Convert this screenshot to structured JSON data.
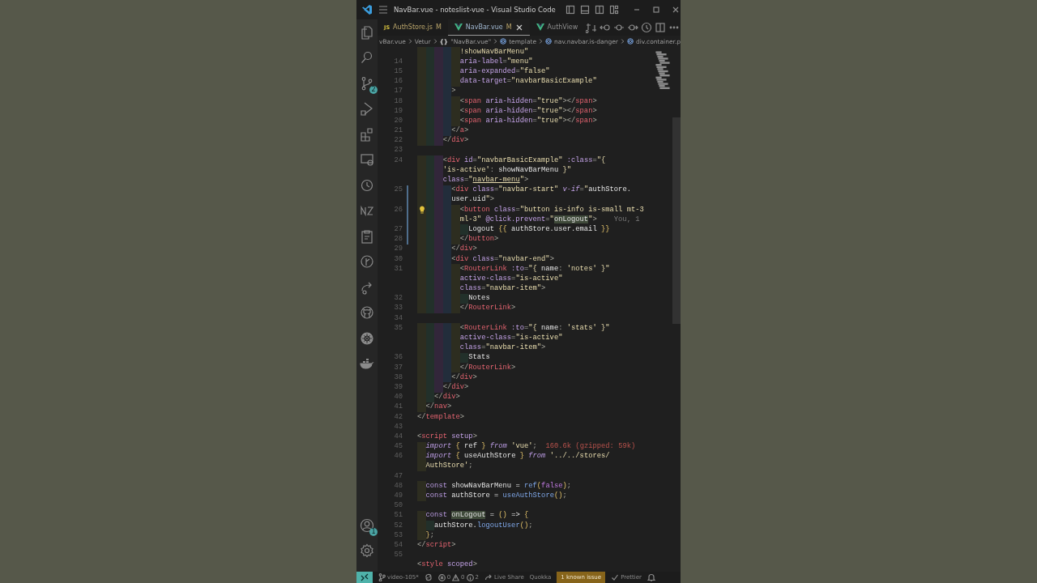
{
  "window": {
    "title": "NavBar.vue - noteslist-vue - Visual Studio Code"
  },
  "activity_bar": {
    "items": [
      {
        "kind": "explorer"
      },
      {
        "kind": "search"
      },
      {
        "kind": "source-control",
        "badge": "2"
      },
      {
        "kind": "run"
      },
      {
        "kind": "extensions"
      },
      {
        "kind": "remote"
      },
      {
        "kind": "target"
      },
      {
        "kind": "zigzag"
      },
      {
        "kind": "clipboard"
      },
      {
        "kind": "timeline"
      },
      {
        "kind": "share"
      },
      {
        "kind": "round"
      },
      {
        "kind": "wheel"
      },
      {
        "kind": "whale"
      }
    ],
    "bottom_items": [
      {
        "kind": "account",
        "badge": "1"
      },
      {
        "kind": "settings"
      }
    ]
  },
  "tabs": [
    {
      "kind": "js",
      "icon_text": "JS",
      "label": "AuthStore.js",
      "status": "M",
      "selected": false
    },
    {
      "kind": "vue",
      "label": "NavBar.vue",
      "status": "M",
      "selected": true
    },
    {
      "kind": "vue",
      "label": "AuthView",
      "selected": false
    }
  ],
  "breadcrumbs": [
    {
      "kind": "plain",
      "label": "vBar.vue"
    },
    {
      "kind": "plain",
      "label": "Vetur"
    },
    {
      "kind": "object",
      "symbol": "{}",
      "label": "\"NavBar.vue\""
    },
    {
      "kind": "element",
      "label": "template"
    },
    {
      "kind": "element",
      "label": "nav.navbar.is-danger"
    },
    {
      "kind": "element",
      "label": "div.container.p"
    }
  ],
  "editor": {
    "rows": [
      {
        "tokens": [
          {
            "kind": "string",
            "text": "          !showNavBarMenu\""
          }
        ]
      },
      {
        "number": "14",
        "tokens": [
          {
            "kind": "attr",
            "text": "          aria-label"
          },
          {
            "kind": "punct",
            "text": "="
          },
          {
            "kind": "string",
            "text": "\"menu\""
          }
        ]
      },
      {
        "number": "15",
        "tokens": [
          {
            "kind": "attr",
            "text": "          aria-expanded"
          },
          {
            "kind": "punct",
            "text": "="
          },
          {
            "kind": "string",
            "text": "\"false\""
          }
        ]
      },
      {
        "number": "16",
        "tokens": [
          {
            "kind": "attr",
            "text": "          data-target"
          },
          {
            "kind": "punct",
            "text": "="
          },
          {
            "kind": "string",
            "text": "\"navbarBasicExample\""
          }
        ]
      },
      {
        "number": "17",
        "tokens": [
          {
            "kind": "punct",
            "text": "        >"
          }
        ]
      },
      {
        "number": "18",
        "tokens": [
          {
            "kind": "punct",
            "text": "          <"
          },
          {
            "kind": "tag",
            "text": "span"
          },
          {
            "kind": "attr",
            "text": " aria-hidden"
          },
          {
            "kind": "punct",
            "text": "="
          },
          {
            "kind": "string",
            "text": "\"true\""
          },
          {
            "kind": "punct",
            "text": "></"
          },
          {
            "kind": "tag",
            "text": "span"
          },
          {
            "kind": "punct",
            "text": ">"
          }
        ]
      },
      {
        "number": "19",
        "tokens": [
          {
            "kind": "punct",
            "text": "          <"
          },
          {
            "kind": "tag",
            "text": "span"
          },
          {
            "kind": "attr",
            "text": " aria-hidden"
          },
          {
            "kind": "punct",
            "text": "="
          },
          {
            "kind": "string",
            "text": "\"true\""
          },
          {
            "kind": "punct",
            "text": "></"
          },
          {
            "kind": "tag",
            "text": "span"
          },
          {
            "kind": "punct",
            "text": ">"
          }
        ]
      },
      {
        "number": "20",
        "tokens": [
          {
            "kind": "punct",
            "text": "          <"
          },
          {
            "kind": "tag",
            "text": "span"
          },
          {
            "kind": "attr",
            "text": " aria-hidden"
          },
          {
            "kind": "punct",
            "text": "="
          },
          {
            "kind": "string",
            "text": "\"true\""
          },
          {
            "kind": "punct",
            "text": "></"
          },
          {
            "kind": "tag",
            "text": "span"
          },
          {
            "kind": "punct",
            "text": ">"
          }
        ]
      },
      {
        "number": "21",
        "tokens": [
          {
            "kind": "punct",
            "text": "        </"
          },
          {
            "kind": "tag",
            "text": "a"
          },
          {
            "kind": "punct",
            "text": ">"
          }
        ]
      },
      {
        "number": "22",
        "tokens": [
          {
            "kind": "punct",
            "text": "      </"
          },
          {
            "kind": "tag",
            "text": "div"
          },
          {
            "kind": "punct",
            "text": ">"
          }
        ]
      },
      {
        "number": "23"
      },
      {
        "number": "24",
        "tokens": [
          {
            "kind": "punct",
            "text": "      <"
          },
          {
            "kind": "tag",
            "text": "div"
          },
          {
            "kind": "attr",
            "text": " id"
          },
          {
            "kind": "punct",
            "text": "="
          },
          {
            "kind": "string",
            "text": "\"navbarBasicExample\""
          },
          {
            "kind": "attr",
            "text": " :class"
          },
          {
            "kind": "punct",
            "text": "="
          },
          {
            "kind": "string",
            "text": "\"{"
          }
        ]
      },
      {
        "tokens": [
          {
            "kind": "string",
            "text": "      'is-active'"
          },
          {
            "kind": "punct",
            "text": ":"
          },
          {
            "kind": "text",
            "text": " showNavBarMenu "
          },
          {
            "kind": "string",
            "text": "}\""
          }
        ]
      },
      {
        "tokens": [
          {
            "kind": "attr",
            "text": "      class"
          },
          {
            "kind": "punct",
            "text": "="
          },
          {
            "kind": "string",
            "text": "\""
          },
          {
            "kind": "link",
            "text": "navbar-menu"
          },
          {
            "kind": "string",
            "text": "\""
          },
          {
            "kind": "punct",
            "text": ">"
          }
        ]
      },
      {
        "number": "25",
        "modified": true,
        "tokens": [
          {
            "kind": "punct",
            "text": "        <"
          },
          {
            "kind": "tag",
            "text": "div"
          },
          {
            "kind": "attr",
            "text": " class"
          },
          {
            "kind": "punct",
            "text": "="
          },
          {
            "kind": "string",
            "text": "\"navbar-start\""
          },
          {
            "kind": "directive",
            "text": " v-if"
          },
          {
            "kind": "punct",
            "text": "="
          },
          {
            "kind": "string",
            "text": "\""
          },
          {
            "kind": "text",
            "text": "authStore."
          }
        ]
      },
      {
        "modified": true,
        "tokens": [
          {
            "kind": "text",
            "text": "        user.uid"
          },
          {
            "kind": "string",
            "text": "\""
          },
          {
            "kind": "punct",
            "text": ">"
          }
        ]
      },
      {
        "number": "26",
        "modified": true,
        "lightbulb": true,
        "tokens": [
          {
            "kind": "punct",
            "text": "          <"
          },
          {
            "kind": "tag",
            "text": "button"
          },
          {
            "kind": "attr",
            "text": " class"
          },
          {
            "kind": "punct",
            "text": "="
          },
          {
            "kind": "string",
            "text": "\"button is-info is-small mt-3"
          }
        ]
      },
      {
        "modified": true,
        "blame": "You, 1",
        "tokens": [
          {
            "kind": "string",
            "text": "          ml-3\""
          },
          {
            "kind": "attr",
            "text": " @click.prevent"
          },
          {
            "kind": "punct",
            "text": "="
          },
          {
            "kind": "string",
            "text": "\""
          },
          {
            "kind": "match",
            "text": "onLogout"
          },
          {
            "kind": "string",
            "text": "\""
          },
          {
            "kind": "punct",
            "text": ">"
          }
        ]
      },
      {
        "number": "27",
        "modified": true,
        "tokens": [
          {
            "kind": "text",
            "text": "            Logout "
          },
          {
            "kind": "brace",
            "text": "{{"
          },
          {
            "kind": "text",
            "text": " authStore.user.email "
          },
          {
            "kind": "brace",
            "text": "}}"
          }
        ]
      },
      {
        "number": "28",
        "modified": true,
        "tokens": [
          {
            "kind": "punct",
            "text": "          </"
          },
          {
            "kind": "tag",
            "text": "button"
          },
          {
            "kind": "punct",
            "text": ">"
          }
        ]
      },
      {
        "number": "29",
        "tokens": [
          {
            "kind": "punct",
            "text": "        </"
          },
          {
            "kind": "tag",
            "text": "div"
          },
          {
            "kind": "punct",
            "text": ">"
          }
        ]
      },
      {
        "number": "30",
        "tokens": [
          {
            "kind": "punct",
            "text": "        <"
          },
          {
            "kind": "tag",
            "text": "div"
          },
          {
            "kind": "attr",
            "text": " class"
          },
          {
            "kind": "punct",
            "text": "="
          },
          {
            "kind": "string",
            "text": "\"navbar-end\""
          },
          {
            "kind": "punct",
            "text": ">"
          }
        ]
      },
      {
        "number": "31",
        "tokens": [
          {
            "kind": "punct",
            "text": "          <"
          },
          {
            "kind": "tag",
            "text": "RouterLink"
          },
          {
            "kind": "attr",
            "text": " :to"
          },
          {
            "kind": "punct",
            "text": "="
          },
          {
            "kind": "string",
            "text": "\"{ "
          },
          {
            "kind": "text",
            "text": "name"
          },
          {
            "kind": "punct",
            "text": ": "
          },
          {
            "kind": "string",
            "text": "'notes' }\""
          }
        ]
      },
      {
        "tokens": [
          {
            "kind": "attr",
            "text": "          active-class"
          },
          {
            "kind": "punct",
            "text": "="
          },
          {
            "kind": "string",
            "text": "\"is-active\""
          }
        ]
      },
      {
        "tokens": [
          {
            "kind": "attr",
            "text": "          class"
          },
          {
            "kind": "punct",
            "text": "="
          },
          {
            "kind": "string",
            "text": "\"navbar-item\""
          },
          {
            "kind": "punct",
            "text": ">"
          }
        ]
      },
      {
        "number": "32",
        "tokens": [
          {
            "kind": "text",
            "text": "            Notes"
          }
        ]
      },
      {
        "number": "33",
        "tokens": [
          {
            "kind": "punct",
            "text": "          </"
          },
          {
            "kind": "tag",
            "text": "RouterLink"
          },
          {
            "kind": "punct",
            "text": ">"
          }
        ]
      },
      {
        "number": "34"
      },
      {
        "number": "35",
        "tokens": [
          {
            "kind": "punct",
            "text": "          <"
          },
          {
            "kind": "tag",
            "text": "RouterLink"
          },
          {
            "kind": "attr",
            "text": " :to"
          },
          {
            "kind": "punct",
            "text": "="
          },
          {
            "kind": "string",
            "text": "\"{ "
          },
          {
            "kind": "text",
            "text": "name"
          },
          {
            "kind": "punct",
            "text": ": "
          },
          {
            "kind": "string",
            "text": "'stats' }\""
          }
        ]
      },
      {
        "tokens": [
          {
            "kind": "attr",
            "text": "          active-class"
          },
          {
            "kind": "punct",
            "text": "="
          },
          {
            "kind": "string",
            "text": "\"is-active\""
          }
        ]
      },
      {
        "tokens": [
          {
            "kind": "attr",
            "text": "          class"
          },
          {
            "kind": "punct",
            "text": "="
          },
          {
            "kind": "string",
            "text": "\"navbar-item\""
          },
          {
            "kind": "punct",
            "text": ">"
          }
        ]
      },
      {
        "number": "36",
        "tokens": [
          {
            "kind": "text",
            "text": "            Stats"
          }
        ]
      },
      {
        "number": "37",
        "tokens": [
          {
            "kind": "punct",
            "text": "          </"
          },
          {
            "kind": "tag",
            "text": "RouterLink"
          },
          {
            "kind": "punct",
            "text": ">"
          }
        ]
      },
      {
        "number": "38",
        "tokens": [
          {
            "kind": "punct",
            "text": "        </"
          },
          {
            "kind": "tag",
            "text": "div"
          },
          {
            "kind": "punct",
            "text": ">"
          }
        ]
      },
      {
        "number": "39",
        "tokens": [
          {
            "kind": "punct",
            "text": "      </"
          },
          {
            "kind": "tag",
            "text": "div"
          },
          {
            "kind": "punct",
            "text": ">"
          }
        ]
      },
      {
        "number": "40",
        "tokens": [
          {
            "kind": "punct",
            "text": "    </"
          },
          {
            "kind": "tag",
            "text": "div"
          },
          {
            "kind": "punct",
            "text": ">"
          }
        ]
      },
      {
        "number": "41",
        "tokens": [
          {
            "kind": "punct",
            "text": "  </"
          },
          {
            "kind": "tag",
            "text": "nav"
          },
          {
            "kind": "punct",
            "text": ">"
          }
        ]
      },
      {
        "number": "42",
        "tokens": [
          {
            "kind": "punct",
            "text": "</"
          },
          {
            "kind": "tag",
            "text": "template"
          },
          {
            "kind": "punct",
            "text": ">"
          }
        ]
      },
      {
        "number": "43"
      },
      {
        "number": "44",
        "tokens": [
          {
            "kind": "punct",
            "text": "<"
          },
          {
            "kind": "tag",
            "text": "script"
          },
          {
            "kind": "attr",
            "text": " setup"
          },
          {
            "kind": "punct",
            "text": ">"
          }
        ]
      },
      {
        "number": "45",
        "hint": "160.6k (gzipped: 59k)",
        "tokens": [
          {
            "kind": "keyword",
            "text": "  import"
          },
          {
            "kind": "brace",
            "text": " {"
          },
          {
            "kind": "text",
            "text": " ref "
          },
          {
            "kind": "brace",
            "text": "}"
          },
          {
            "kind": "keyword",
            "text": " from"
          },
          {
            "kind": "string",
            "text": " 'vue'"
          },
          {
            "kind": "punct",
            "text": ";"
          }
        ]
      },
      {
        "number": "46",
        "tokens": [
          {
            "kind": "keyword",
            "text": "  import"
          },
          {
            "kind": "brace",
            "text": " {"
          },
          {
            "kind": "text",
            "text": " useAuthStore "
          },
          {
            "kind": "brace",
            "text": "}"
          },
          {
            "kind": "keyword",
            "text": " from"
          },
          {
            "kind": "string",
            "text": " '../../stores/"
          }
        ]
      },
      {
        "tokens": [
          {
            "kind": "string",
            "text": "  AuthStore'"
          },
          {
            "kind": "punct",
            "text": ";"
          }
        ]
      },
      {
        "number": "47"
      },
      {
        "number": "48",
        "tokens": [
          {
            "kind": "storage",
            "text": "  const"
          },
          {
            "kind": "text",
            "text": " showNavBarMenu = "
          },
          {
            "kind": "function",
            "text": "ref"
          },
          {
            "kind": "brace",
            "text": "("
          },
          {
            "kind": "literal",
            "text": "false"
          },
          {
            "kind": "brace",
            "text": ")"
          },
          {
            "kind": "punct",
            "text": ";"
          }
        ]
      },
      {
        "number": "49",
        "tokens": [
          {
            "kind": "storage",
            "text": "  const"
          },
          {
            "kind": "text",
            "text": " authStore = "
          },
          {
            "kind": "function",
            "text": "useAuthStore"
          },
          {
            "kind": "brace",
            "text": "()"
          },
          {
            "kind": "punct",
            "text": ";"
          }
        ]
      },
      {
        "number": "50"
      },
      {
        "number": "51",
        "tokens": [
          {
            "kind": "storage",
            "text": "  const "
          },
          {
            "kind": "match",
            "text": "onLogout"
          },
          {
            "kind": "text",
            "text": " = "
          },
          {
            "kind": "brace",
            "text": "()"
          },
          {
            "kind": "text",
            "text": " => "
          },
          {
            "kind": "brace",
            "text": "{"
          }
        ]
      },
      {
        "number": "52",
        "tokens": [
          {
            "kind": "text",
            "text": "    authStore."
          },
          {
            "kind": "function",
            "text": "logoutUser"
          },
          {
            "kind": "brace",
            "text": "()"
          },
          {
            "kind": "punct",
            "text": ";"
          }
        ]
      },
      {
        "number": "53",
        "tokens": [
          {
            "kind": "brace",
            "text": "  }"
          },
          {
            "kind": "punct",
            "text": ";"
          }
        ]
      },
      {
        "number": "54",
        "tokens": [
          {
            "kind": "punct",
            "text": "</"
          },
          {
            "kind": "tag",
            "text": "script"
          },
          {
            "kind": "punct",
            "text": ">"
          }
        ]
      },
      {
        "number": "55"
      },
      {
        "tokens": [
          {
            "kind": "punct",
            "text": "<"
          },
          {
            "kind": "tag",
            "text": "style"
          },
          {
            "kind": "attr",
            "text": " scoped"
          },
          {
            "kind": "punct",
            "text": ">"
          }
        ]
      }
    ]
  },
  "status_bar": {
    "branch": "video-105*",
    "errors": "0",
    "warnings": "0",
    "infos": "2",
    "items": [
      {
        "kind": "share",
        "label": "Live Share"
      },
      {
        "kind": "plain",
        "label": "Quokka"
      },
      {
        "kind": "highlight",
        "label": "1 known issue"
      },
      {
        "kind": "check",
        "label": "Prettier"
      }
    ]
  }
}
